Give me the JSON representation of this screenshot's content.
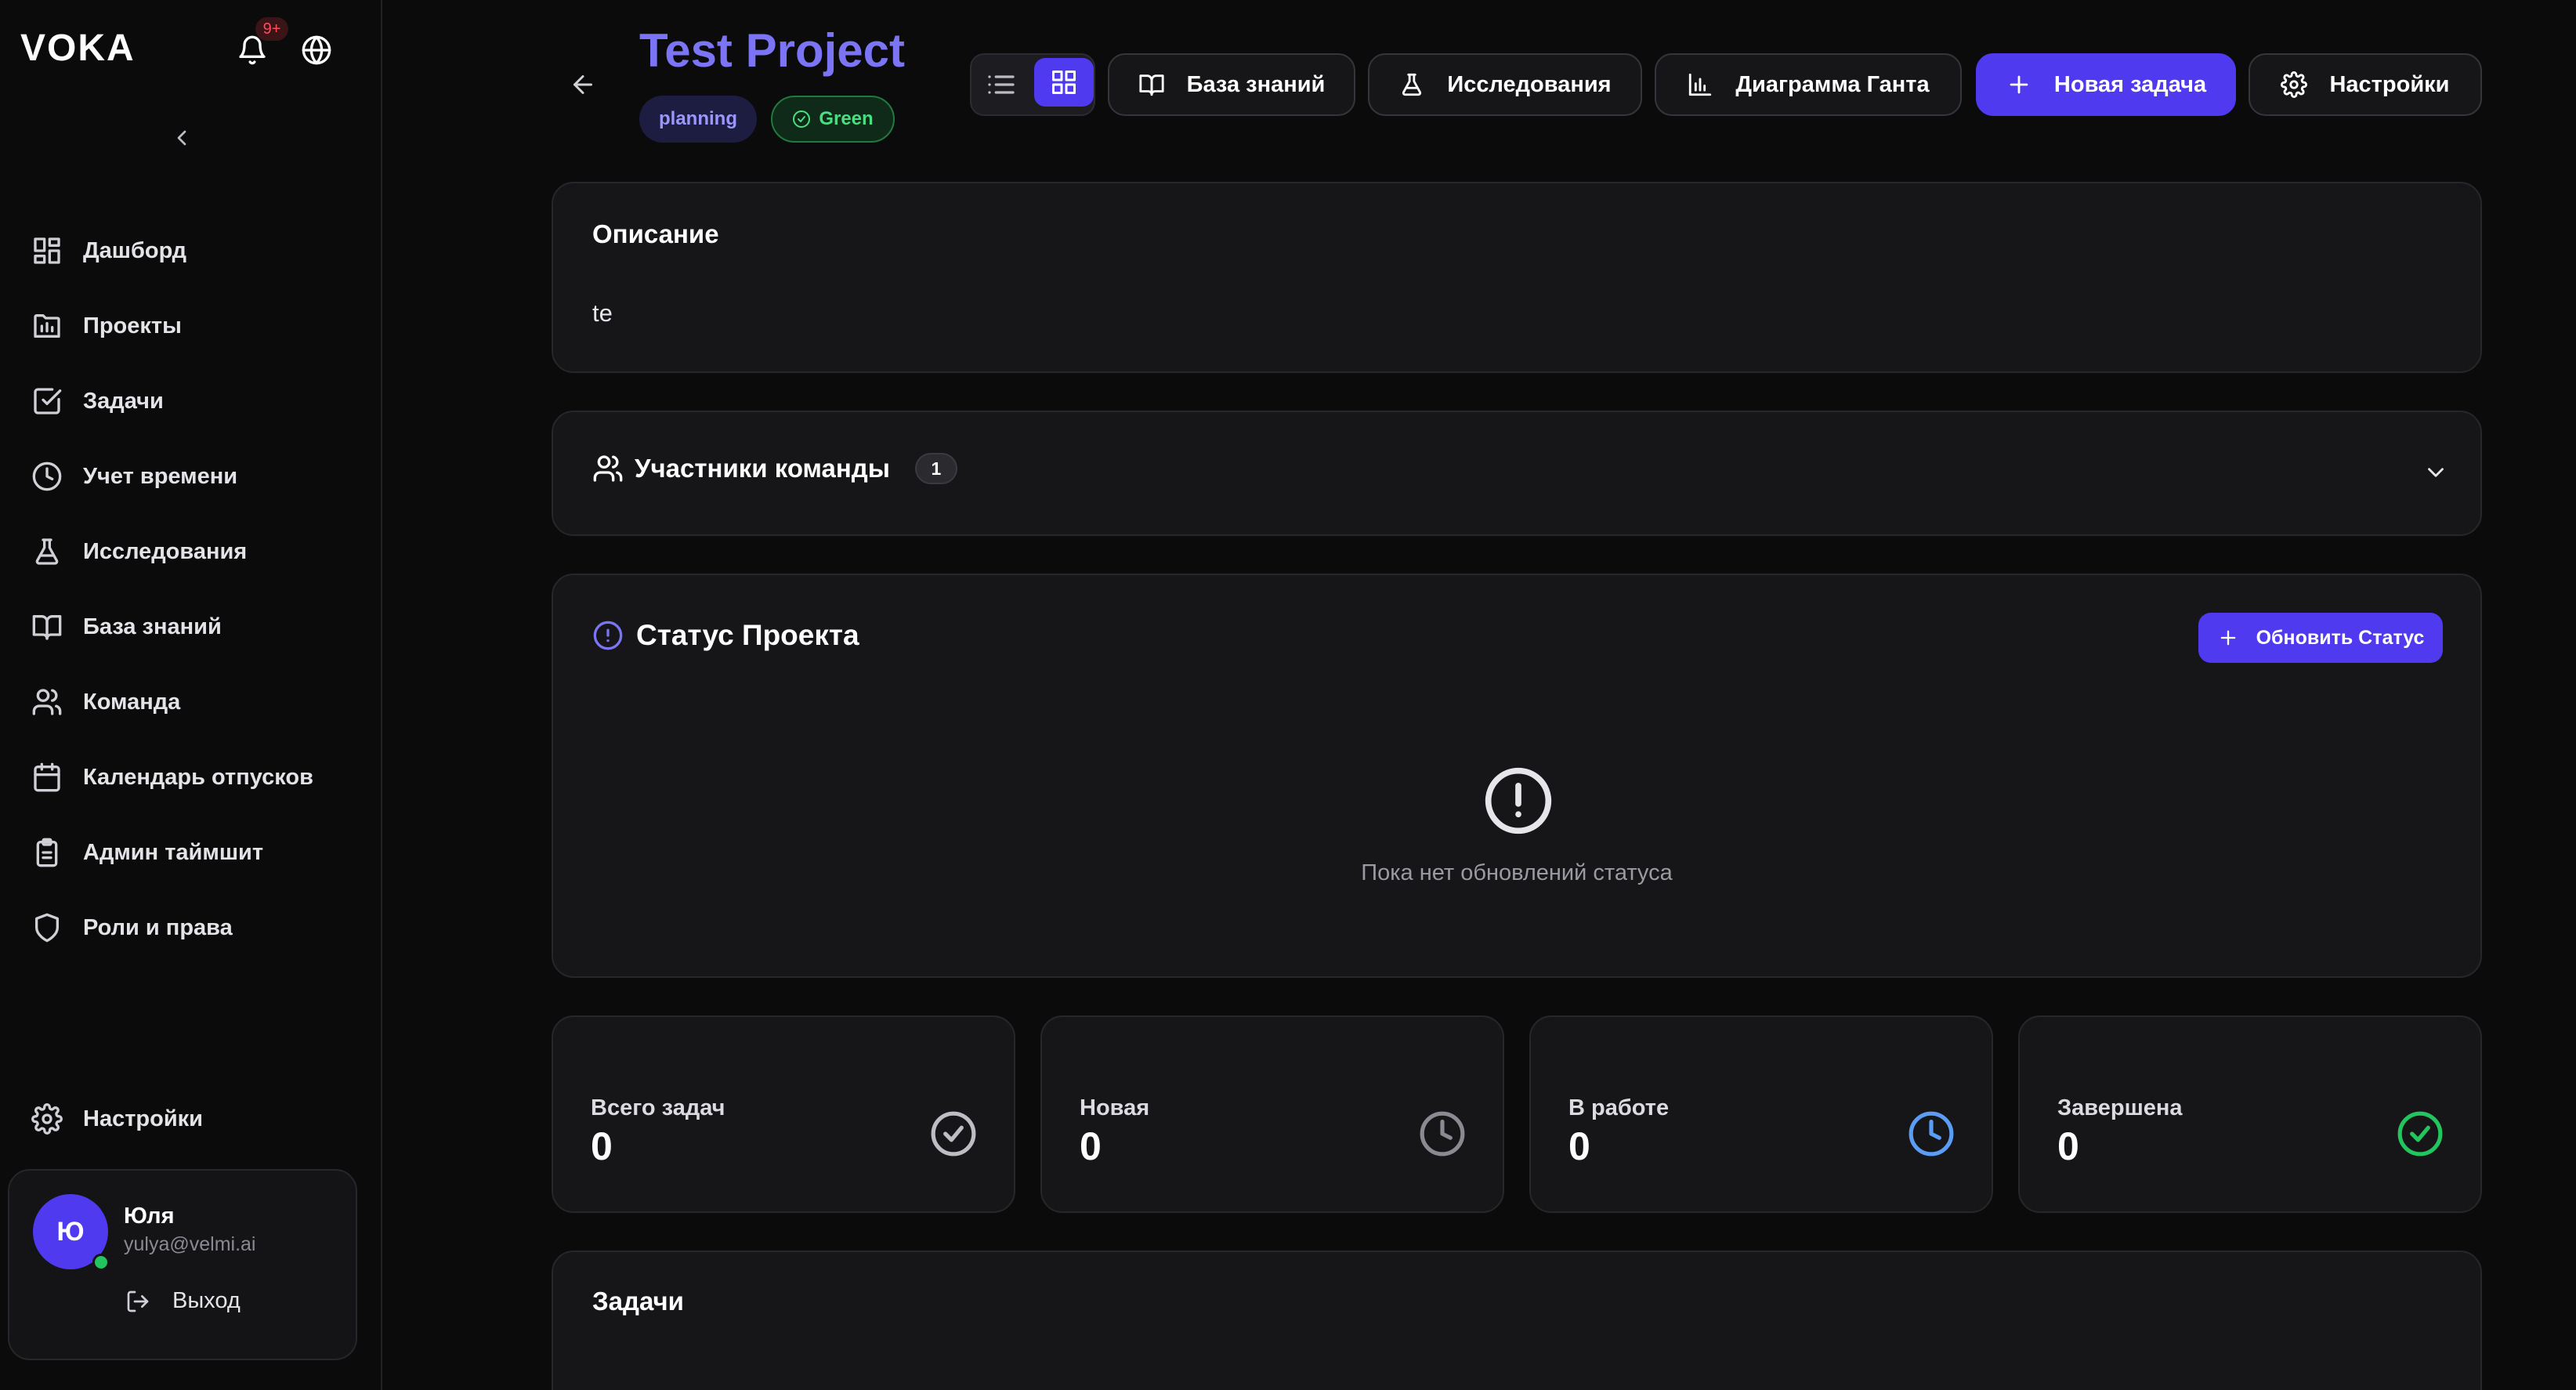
{
  "app": {
    "logo": "VOKA",
    "notifications_badge": "9+"
  },
  "sidebar": {
    "items": [
      {
        "label": "Дашборд",
        "icon": "dashboard-icon"
      },
      {
        "label": "Проекты",
        "icon": "projects-icon"
      },
      {
        "label": "Задачи",
        "icon": "tasks-icon"
      },
      {
        "label": "Учет времени",
        "icon": "clock-icon"
      },
      {
        "label": "Исследования",
        "icon": "flask-icon"
      },
      {
        "label": "База знаний",
        "icon": "book-icon"
      },
      {
        "label": "Команда",
        "icon": "users-icon"
      },
      {
        "label": "Календарь отпусков",
        "icon": "calendar-icon"
      },
      {
        "label": "Админ таймшит",
        "icon": "clipboard-icon"
      },
      {
        "label": "Роли и права",
        "icon": "shield-icon"
      }
    ],
    "settings_label": "Настройки",
    "user": {
      "initial": "Ю",
      "name": "Юля",
      "email": "yulya@velmi.ai",
      "logout_label": "Выход"
    }
  },
  "header": {
    "title": "Test Project",
    "status_tag": "planning",
    "health_tag": "Green",
    "buttons": {
      "knowledge_base": "База знаний",
      "research": "Исследования",
      "gantt": "Диаграмма Ганта",
      "new_task": "Новая задача",
      "settings": "Настройки"
    }
  },
  "description": {
    "title": "Описание",
    "text": "te"
  },
  "team": {
    "title": "Участники команды",
    "count": "1"
  },
  "project_status": {
    "title": "Статус Проекта",
    "update_button": "Обновить Статус",
    "empty_text": "Пока нет обновлений статуса"
  },
  "stats": [
    {
      "label": "Всего задач",
      "value": "0",
      "icon": "check-circle-icon",
      "color": "#bdbdc4"
    },
    {
      "label": "Новая",
      "value": "0",
      "icon": "clock-icon",
      "color": "#8a8a93"
    },
    {
      "label": "В работе",
      "value": "0",
      "icon": "clock-icon",
      "color": "#5b9cf5"
    },
    {
      "label": "Завершена",
      "value": "0",
      "icon": "check-circle-icon",
      "color": "#22c55e"
    }
  ],
  "tasks": {
    "title": "Задачи"
  },
  "colors": {
    "accent": "#4f3af0",
    "title": "#7b74f4",
    "background": "#0b0b0c",
    "card": "#161618"
  }
}
